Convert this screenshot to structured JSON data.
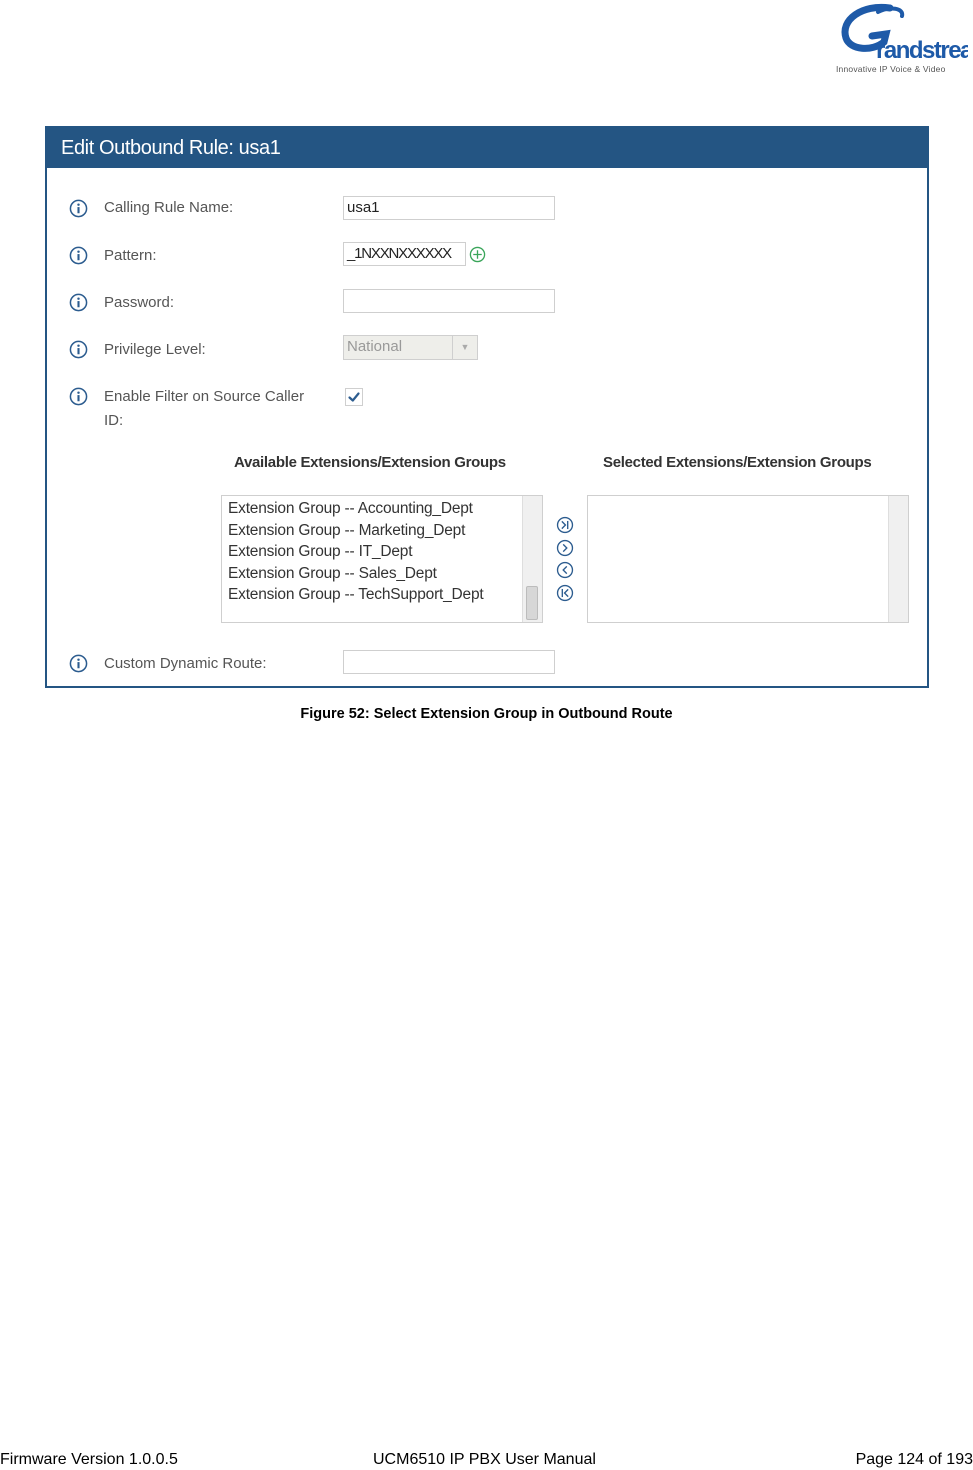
{
  "brand": {
    "name": "Grandstream",
    "tagline": "Innovative IP Voice & Video"
  },
  "dialog": {
    "title": "Edit Outbound Rule: usa1",
    "fields": {
      "calling_rule_name": {
        "label": "Calling Rule Name:",
        "value": "usa1"
      },
      "pattern": {
        "label": "Pattern:",
        "value": "_1NXXNXXXXXX"
      },
      "password": {
        "label": "Password:",
        "value": ""
      },
      "privilege_level": {
        "label": "Privilege Level:",
        "value": "National"
      },
      "enable_filter": {
        "label_line1": "Enable Filter on Source Caller",
        "label_line2": "ID:",
        "checked": true
      },
      "custom_dynamic_route": {
        "label": "Custom Dynamic Route:",
        "value": ""
      }
    },
    "available": {
      "title": "Available Extensions/Extension Groups",
      "items": [
        "Extension Group -- Accounting_Dept",
        "Extension Group -- Marketing_Dept",
        "Extension Group -- IT_Dept",
        "Extension Group -- Sales_Dept",
        "Extension Group -- TechSupport_Dept"
      ]
    },
    "selected": {
      "title": "Selected Extensions/Extension Groups",
      "items": []
    },
    "move_buttons": [
      "move-all-right",
      "move-right",
      "move-left",
      "move-all-left"
    ]
  },
  "caption": "Figure 52: Select Extension Group in Outbound Route",
  "footer": {
    "left": "Firmware Version 1.0.0.5",
    "center": "UCM6510 IP PBX User Manual",
    "right": "Page 124 of 193"
  },
  "colors": {
    "header_bg": "#245583",
    "add_icon": "#3aa55a",
    "icon_blue": "#2c5c8f"
  }
}
